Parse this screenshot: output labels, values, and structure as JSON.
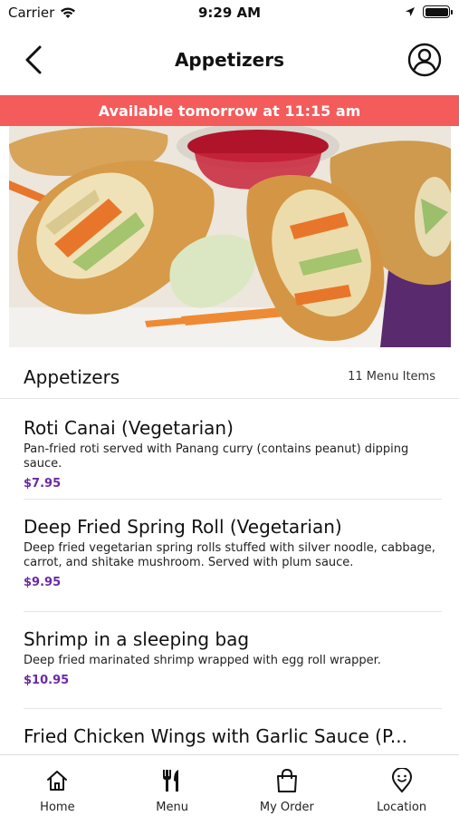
{
  "status_bar": {
    "carrier": "Carrier",
    "time": "9:29 AM"
  },
  "nav": {
    "title": "Appetizers"
  },
  "banner": {
    "text": "Available tomorrow at 11:15 am",
    "color": "#f45b5b"
  },
  "section": {
    "name": "Appetizers",
    "count": "11 Menu Items"
  },
  "menu_items": [
    {
      "name": "Roti Canai (Vegetarian)",
      "description": "Pan-fried roti served with Panang curry (contains peanut) dipping sauce.",
      "price": "$7.95"
    },
    {
      "name": "Deep Fried Spring Roll (Vegetarian)",
      "description": "Deep fried vegetarian spring rolls stuffed with silver noodle, cabbage, carrot,  and shitake mushroom. Served with plum sauce.",
      "price": "$9.95"
    },
    {
      "name": "Shrimp in a sleeping bag",
      "description": "Deep fried marinated shrimp wrapped with egg roll wrapper.",
      "price": "$10.95"
    },
    {
      "name": "Fried Chicken Wings with Garlic Sauce (P...",
      "description": "",
      "price": ""
    }
  ],
  "tabs": [
    {
      "label": "Home",
      "icon": "home-icon"
    },
    {
      "label": "Menu",
      "icon": "fork-knife-icon"
    },
    {
      "label": "My Order",
      "icon": "shopping-bag-icon"
    },
    {
      "label": "Location",
      "icon": "location-pin-icon"
    }
  ],
  "colors": {
    "price": "#6a2aa6",
    "banner": "#f45b5b"
  }
}
